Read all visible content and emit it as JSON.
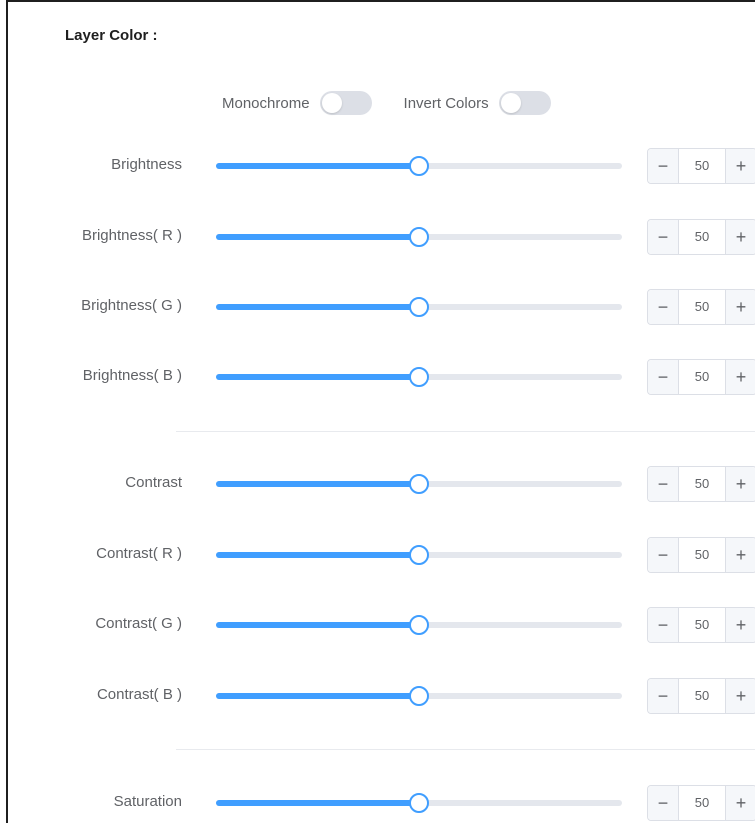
{
  "panel": {
    "title": "Layer Color :",
    "toggles": [
      {
        "label": "Monochrome",
        "on": false
      },
      {
        "label": "Invert Colors",
        "on": false
      }
    ],
    "sliders": [
      {
        "label": "Brightness",
        "value": "50",
        "percent": 50
      },
      {
        "label": "Brightness( R )",
        "value": "50",
        "percent": 50
      },
      {
        "label": "Brightness( G )",
        "value": "50",
        "percent": 50
      },
      {
        "label": "Brightness( B )",
        "value": "50",
        "percent": 50
      },
      {
        "label": "Contrast",
        "value": "50",
        "percent": 50
      },
      {
        "label": "Contrast( R )",
        "value": "50",
        "percent": 50
      },
      {
        "label": "Contrast( G )",
        "value": "50",
        "percent": 50
      },
      {
        "label": "Contrast( B )",
        "value": "50",
        "percent": 50
      },
      {
        "label": "Saturation",
        "value": "50",
        "percent": 50
      }
    ],
    "stepper": {
      "minus_icon": "minus-icon",
      "plus_icon": "plus-icon",
      "minus_glyph": "−",
      "plus_glyph": "+"
    }
  },
  "colors": {
    "accent": "#409eff",
    "track": "#e4e7ed",
    "switch_off": "#dcdfe6"
  }
}
